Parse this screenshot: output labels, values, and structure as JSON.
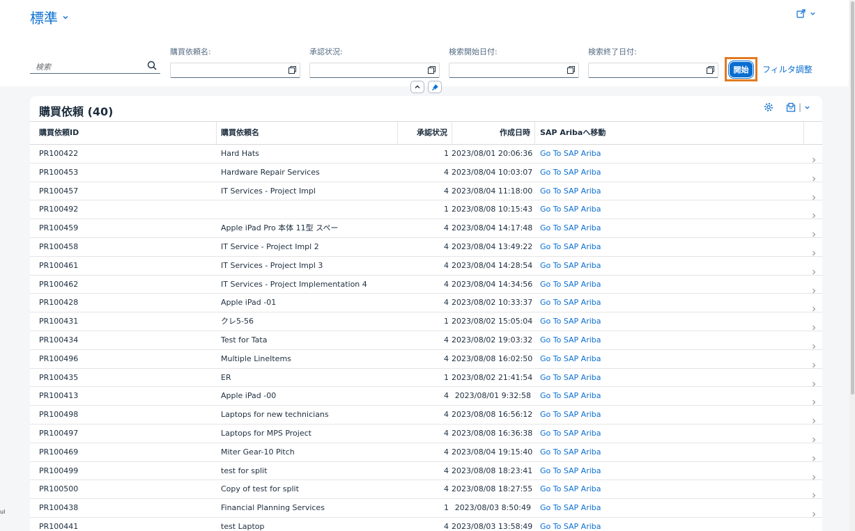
{
  "variant": {
    "title": "標準"
  },
  "search": {
    "placeholder": "検索"
  },
  "filters": [
    {
      "label": "購買依頼名:",
      "value": ""
    },
    {
      "label": "承認状況:",
      "value": ""
    },
    {
      "label": "検索開始日付:",
      "value": ""
    },
    {
      "label": "検索終了日付:",
      "value": ""
    }
  ],
  "actions": {
    "go_label": "開始",
    "adapt_label": "フィルタ調整"
  },
  "table": {
    "title": "購買依頼 (40)",
    "columns": [
      "購買依頼ID",
      "購買依頼名",
      "承認状況",
      "作成日時",
      "SAP Aribaへ移動"
    ],
    "rows": [
      {
        "id": "PR100422",
        "name": "Hard Hats",
        "status": "1",
        "created": "2023/08/01 20:06:36",
        "link": "Go To SAP Ariba"
      },
      {
        "id": "PR100453",
        "name": "Hardware Repair Services",
        "status": "4",
        "created": "2023/08/04 10:03:07",
        "link": "Go To SAP Ariba"
      },
      {
        "id": "PR100457",
        "name": "IT Services - Project Impl",
        "status": "4",
        "created": "2023/08/04 11:18:00",
        "link": "Go To SAP Ariba"
      },
      {
        "id": "PR100492",
        "name": "",
        "status": "1",
        "created": "2023/08/08 10:15:43",
        "link": "Go To SAP Ariba"
      },
      {
        "id": "PR100459",
        "name": "Apple iPad Pro 本体 11型 スペー",
        "status": "4",
        "created": "2023/08/04 14:17:48",
        "link": "Go To SAP Ariba"
      },
      {
        "id": "PR100458",
        "name": "IT Service - Project Impl 2",
        "status": "4",
        "created": "2023/08/04 13:49:22",
        "link": "Go To SAP Ariba"
      },
      {
        "id": "PR100461",
        "name": "IT Services - Project Impl 3",
        "status": "4",
        "created": "2023/08/04 14:28:54",
        "link": "Go To SAP Ariba"
      },
      {
        "id": "PR100462",
        "name": "IT Services - Project Implementation 4",
        "status": "4",
        "created": "2023/08/04 14:34:56",
        "link": "Go To SAP Ariba"
      },
      {
        "id": "PR100428",
        "name": "Apple iPad -01",
        "status": "4",
        "created": "2023/08/02 10:33:37",
        "link": "Go To SAP Ariba"
      },
      {
        "id": "PR100431",
        "name": "クレ5-56",
        "status": "1",
        "created": "2023/08/02 15:05:04",
        "link": "Go To SAP Ariba"
      },
      {
        "id": "PR100434",
        "name": "Test for Tata",
        "status": "4",
        "created": "2023/08/02 19:03:32",
        "link": "Go To SAP Ariba"
      },
      {
        "id": "PR100496",
        "name": "Multiple LineItems",
        "status": "4",
        "created": "2023/08/08 16:02:50",
        "link": "Go To SAP Ariba"
      },
      {
        "id": "PR100435",
        "name": "ER",
        "status": "1",
        "created": "2023/08/02 21:41:54",
        "link": "Go To SAP Ariba"
      },
      {
        "id": "PR100413",
        "name": "Apple iPad -00",
        "status": "4",
        "created": "2023/08/01 9:32:58",
        "link": "Go To SAP Ariba"
      },
      {
        "id": "PR100498",
        "name": "Laptops for new technicians",
        "status": "4",
        "created": "2023/08/08 16:56:12",
        "link": "Go To SAP Ariba"
      },
      {
        "id": "PR100497",
        "name": "Laptops for MPS Project",
        "status": "4",
        "created": "2023/08/08 16:36:38",
        "link": "Go To SAP Ariba"
      },
      {
        "id": "PR100469",
        "name": "Miter Gear-10 Pitch",
        "status": "4",
        "created": "2023/08/04 19:15:40",
        "link": "Go To SAP Ariba"
      },
      {
        "id": "PR100499",
        "name": "test for split",
        "status": "4",
        "created": "2023/08/08 18:23:41",
        "link": "Go To SAP Ariba"
      },
      {
        "id": "PR100500",
        "name": "Copy of test for split",
        "status": "4",
        "created": "2023/08/08 18:27:55",
        "link": "Go To SAP Ariba"
      },
      {
        "id": "PR100438",
        "name": "Financial Planning Services",
        "status": "1",
        "created": "2023/08/03 8:50:49",
        "link": "Go To SAP Ariba"
      },
      {
        "id": "PR100441",
        "name": "test Laptop",
        "status": "4",
        "created": "2023/08/03 13:58:49",
        "link": "Go To SAP Ariba"
      }
    ]
  },
  "edge_text": "ul",
  "colors": {
    "accent": "#0a6ed1",
    "highlight": "#e07a21"
  }
}
